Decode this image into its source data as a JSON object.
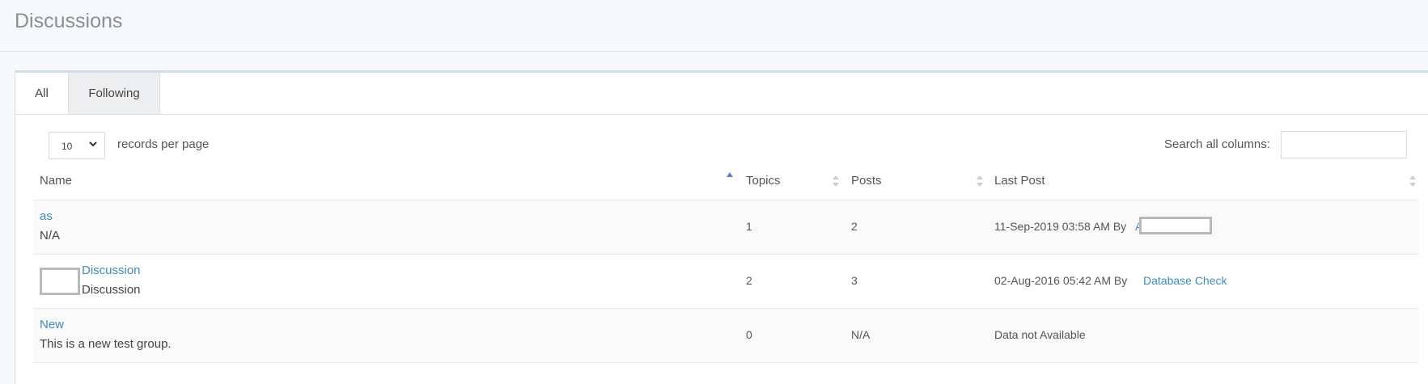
{
  "page": {
    "title": "Discussions"
  },
  "tabs": [
    {
      "label": "All",
      "active": true
    },
    {
      "label": "Following",
      "active": false
    }
  ],
  "table_controls": {
    "length_value": "10",
    "length_suffix": "records per page",
    "search_label": "Search all columns:",
    "search_value": ""
  },
  "columns": {
    "name": "Name",
    "topics": "Topics",
    "posts": "Posts",
    "last_post": "Last Post"
  },
  "rows": [
    {
      "name": "as",
      "description": "N/A",
      "topics": "1",
      "posts": "2",
      "last_post_text": "11-Sep-2019 03:58 AM By",
      "last_post_user": "A"
    },
    {
      "name": "Discussion",
      "description": "Discussion",
      "topics": "2",
      "posts": "3",
      "last_post_text": "02-Aug-2016 05:42 AM By",
      "last_post_user": "Database Check"
    },
    {
      "name": "New",
      "description": "This is a new test group.",
      "topics": "0",
      "posts": "N/A",
      "last_post_text": "Data not Available",
      "last_post_user": ""
    }
  ],
  "colors": {
    "link": "#3c8dbc",
    "sort_active": "#5b7fc7",
    "sort_inactive": "#c9ccd0"
  }
}
